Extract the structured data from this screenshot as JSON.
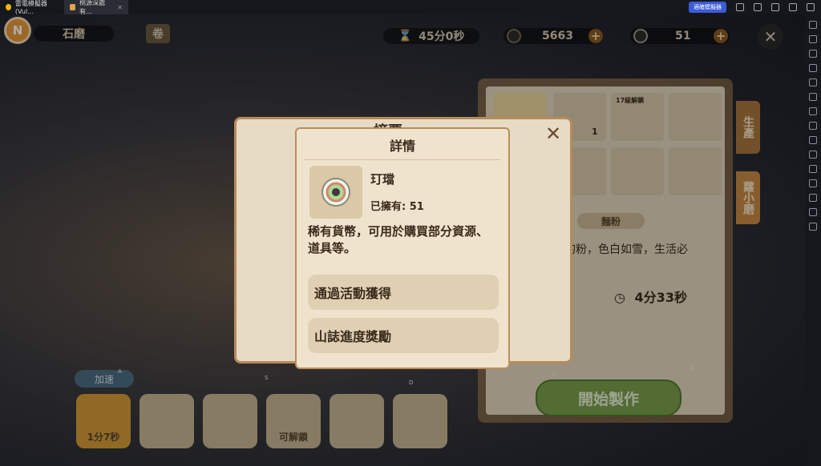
{
  "titlebar": {
    "tabs": [
      {
        "label": "雷電模擬器(Vul...",
        "icon": "ldplayer-icon"
      },
      {
        "label": "桃源深處有...",
        "icon": "game-icon"
      }
    ],
    "accelerator_label": "適確模擬器"
  },
  "hud": {
    "avatar_letter": "N",
    "location": "石磨",
    "time": "45分0秒",
    "coins": "5663",
    "jade": "51"
  },
  "background": {
    "slot_count_label": "1",
    "unlock_label": "17級解鎖",
    "side_tab_produce": "生產",
    "side_tab_mill": "蘿小磨",
    "food_title": "麵粉",
    "food_desc": "的粉，色白如雪，生活必",
    "timer": "4分33秒",
    "start_label": "開始製作",
    "speed_label": "加速",
    "queue": [
      {
        "label": "1分7秒",
        "active": true
      },
      {
        "label": ""
      },
      {
        "label": ""
      },
      {
        "label": "可解鎖"
      },
      {
        "label": ""
      },
      {
        "label": ""
      }
    ],
    "keys": [
      "A",
      "S",
      "D",
      "F",
      "G"
    ],
    "back_dialog_title": "摘要"
  },
  "detail": {
    "title": "詳情",
    "item_name": "玎璫",
    "owned": "已擁有: 51",
    "description": "稀有貨幣，可用於購買部分資源、道具等。",
    "sources": [
      "通過活動獲得",
      "山誌進度獎勵"
    ]
  },
  "colors": {
    "accent": "#b78e5e",
    "panel": "#efe3cd"
  }
}
